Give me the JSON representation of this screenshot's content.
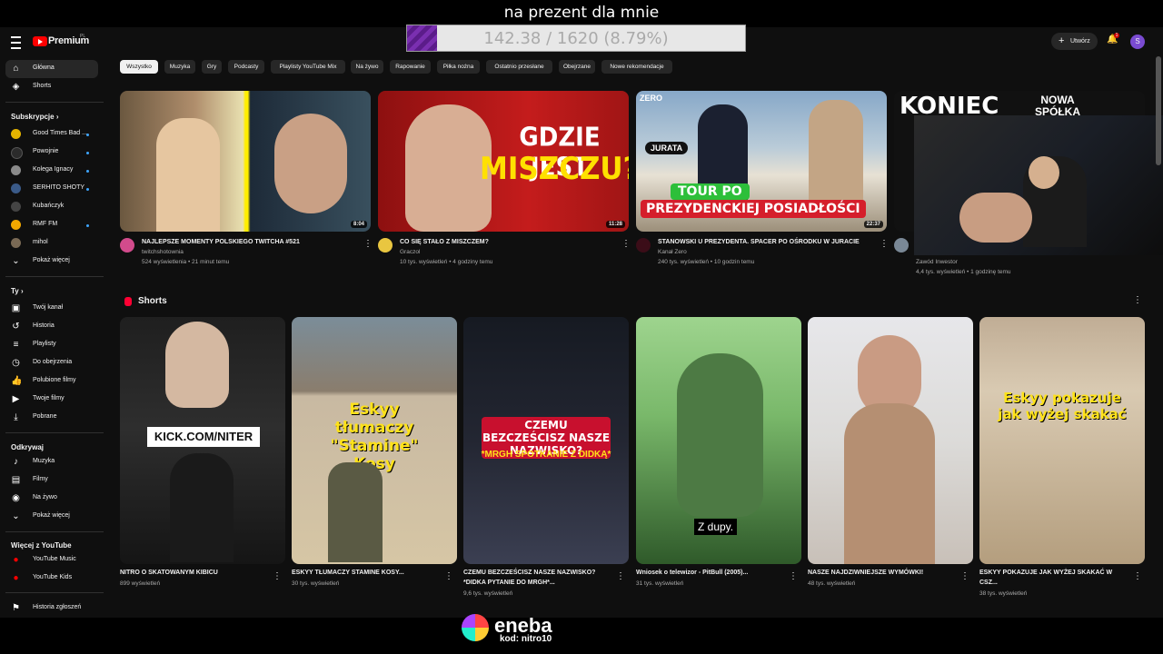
{
  "overlay": {
    "stream_title": "na prezent dla mnie",
    "progress_text": "142.38 / 1620 (8.79%)",
    "progress_fraction": 0.0879,
    "sponsor_name": "eneba",
    "sponsor_code": "kod: nitro10"
  },
  "header": {
    "logo_text": "Premium",
    "country": "PL",
    "create_label": "Utwórz",
    "notif_count": "1",
    "avatar_letter": "S"
  },
  "sidebar": {
    "top_items": [
      {
        "label": "Główna",
        "icon": "home-icon"
      },
      {
        "label": "Shorts",
        "icon": "shorts-icon"
      }
    ],
    "subs_heading": "Subskrypcje",
    "subscriptions": [
      {
        "label": "Good Times Bad ...",
        "color": "#e5b400"
      },
      {
        "label": "Powojnie",
        "color": "#2b2b2b"
      },
      {
        "label": "Kolega Ignacy",
        "color": "#8a8a8a"
      },
      {
        "label": "SERHITO SHOTY",
        "color": "#3a5a88"
      },
      {
        "label": "Kubańczyk",
        "color": "#444444"
      },
      {
        "label": "RMF FM",
        "color": "#f2a800"
      },
      {
        "label": "mihol",
        "color": "#7a6a55"
      }
    ],
    "show_more": "Pokaż więcej",
    "you_heading": "Ty",
    "you_items": [
      {
        "label": "Twój kanał",
        "icon": "channel-icon"
      },
      {
        "label": "Historia",
        "icon": "history-icon"
      },
      {
        "label": "Playlisty",
        "icon": "playlist-icon"
      },
      {
        "label": "Do obejrzenia",
        "icon": "clock-icon"
      },
      {
        "label": "Polubione filmy",
        "icon": "like-icon"
      },
      {
        "label": "Twoje filmy",
        "icon": "video-icon"
      },
      {
        "label": "Pobrane",
        "icon": "download-icon"
      }
    ],
    "explore_heading": "Odkrywaj",
    "explore_items": [
      {
        "label": "Muzyka",
        "icon": "music-icon"
      },
      {
        "label": "Filmy",
        "icon": "film-icon"
      },
      {
        "label": "Na żywo",
        "icon": "live-icon"
      }
    ],
    "explore_more": "Pokaż więcej",
    "more_heading": "Więcej z YouTube",
    "more_items": [
      {
        "label": "YouTube Music"
      },
      {
        "label": "YouTube Kids"
      }
    ],
    "report_history": "Historia zgłoszeń"
  },
  "chips": [
    "Wszystko",
    "Muzyka",
    "Gry",
    "Podcasty",
    "Playlisty YouTube Mix",
    "Na żywo",
    "Rapowanie",
    "Piłka nożna",
    "Ostatnio przesłane",
    "Obejrzane",
    "Nowe rekomendacje"
  ],
  "videos": [
    {
      "title": "NAJLEPSZE MOMENTY POLSKIEGO TWITCHA #521",
      "channel": "twitchshotownia",
      "views": "524 wyświetlenia",
      "age": "21 minut temu",
      "duration": "8:04"
    },
    {
      "title": "CO SIĘ STAŁO Z MISZCZEM?",
      "channel": "Graczol",
      "views": "10 tys. wyświetleń",
      "age": "4 godziny temu",
      "duration": "11:28",
      "thumb_text_1": "GDZIE JEST",
      "thumb_text_2": "MISZCZU?"
    },
    {
      "title": "STANOWSKI U PREZYDENTA. SPACER PO OŚRODKU W JURACIE",
      "channel": "Kanał Zero",
      "views": "240 tys. wyświetleń",
      "age": "10 godzin temu",
      "duration": "22:37",
      "thumb_brand": "ZERO",
      "thumb_place": "JURATA",
      "thumb_text_1": "TOUR PO",
      "thumb_text_2": "PREZYDENCKIEJ POSIADŁOŚCI"
    },
    {
      "title": "",
      "channel": "Zawód Inwestor",
      "views": "4,4 tys. wyświetleń",
      "age": "1 godzinę temu",
      "thumb_text_1": "KONIEC",
      "thumb_text_2": "NOWA SPÓŁKA"
    }
  ],
  "shorts_heading": "Shorts",
  "shorts": [
    {
      "title": "NITRO O SKATOWANYM KIBICU",
      "title2": "",
      "views": "899 wyświetleń",
      "thumb_text": "KICK.COM/NITER"
    },
    {
      "title": "ESKYY TŁUMACZY STAMINE KOSY...",
      "title2": "",
      "views": "30 tys. wyświetleń",
      "thumb_text": "Eskyy tłumaczy \"Stamine\" Kosy"
    },
    {
      "title": "CZEMU BEZCZEŚCISZ NASZE NAZWISKO?",
      "title2": "*DIDKA PYTANIE DO MRGH*...",
      "views": "9,6 tys. wyświetleń",
      "thumb_text": "CZEMU BEZCZEŚCISZ NASZE NAZWISKO?",
      "thumb_sub": "*MRGH SPOTKANIE Z DIDKĄ*"
    },
    {
      "title": "Wniosek o telewizor - PitBull (2005)...",
      "title2": "",
      "views": "31 tys. wyświetleń",
      "thumb_text": "Z dupy."
    },
    {
      "title": "NASZE NAJDZIWNIEJSZE WYMÓWKI!",
      "title2": "",
      "views": "48 tys. wyświetleń",
      "thumb_text": ""
    },
    {
      "title": "ESKYY POKAZUJE JAK WYŻEJ SKAKAĆ W",
      "title2": "CSZ...",
      "views": "38 tys. wyświetleń",
      "thumb_text": "Eskyy pokazuje jak wyżej skakać"
    }
  ]
}
